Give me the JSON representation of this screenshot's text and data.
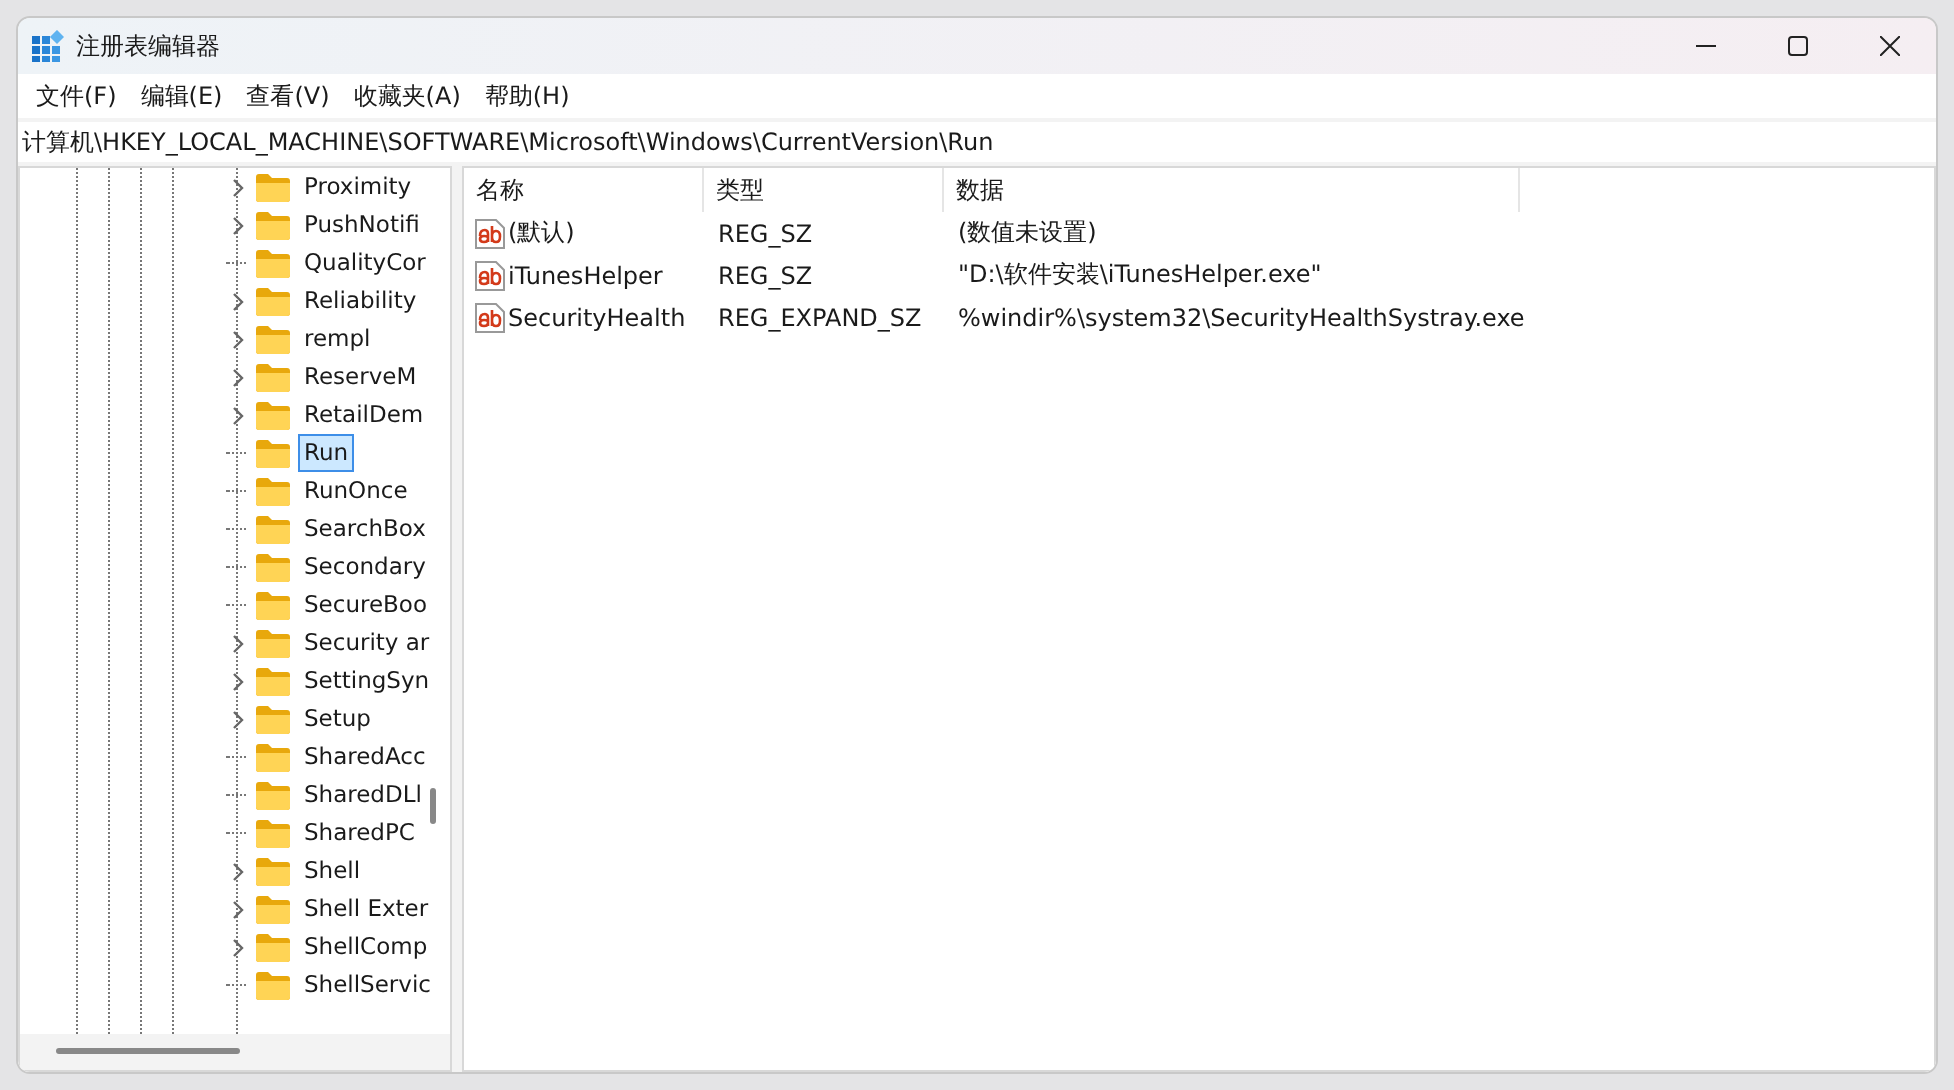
{
  "window": {
    "title": "注册表编辑器"
  },
  "menu": [
    "文件(F)",
    "编辑(E)",
    "查看(V)",
    "收藏夹(A)",
    "帮助(H)"
  ],
  "address": "计算机\\HKEY_LOCAL_MACHINE\\SOFTWARE\\Microsoft\\Windows\\CurrentVersion\\Run",
  "tree": [
    {
      "label": "Proximity",
      "expandable": true,
      "selected": false
    },
    {
      "label": "PushNotifi",
      "expandable": true,
      "selected": false
    },
    {
      "label": "QualityCor",
      "expandable": false,
      "selected": false
    },
    {
      "label": "Reliability",
      "expandable": true,
      "selected": false
    },
    {
      "label": "rempl",
      "expandable": true,
      "selected": false
    },
    {
      "label": "ReserveM",
      "expandable": true,
      "selected": false
    },
    {
      "label": "RetailDem",
      "expandable": true,
      "selected": false
    },
    {
      "label": "Run",
      "expandable": false,
      "selected": true
    },
    {
      "label": "RunOnce",
      "expandable": false,
      "selected": false
    },
    {
      "label": "SearchBox",
      "expandable": false,
      "selected": false
    },
    {
      "label": "Secondary",
      "expandable": false,
      "selected": false
    },
    {
      "label": "SecureBoo",
      "expandable": false,
      "selected": false
    },
    {
      "label": "Security ar",
      "expandable": true,
      "selected": false
    },
    {
      "label": "SettingSyn",
      "expandable": true,
      "selected": false
    },
    {
      "label": "Setup",
      "expandable": true,
      "selected": false
    },
    {
      "label": "SharedAcc",
      "expandable": false,
      "selected": false
    },
    {
      "label": "SharedDLl",
      "expandable": false,
      "selected": false
    },
    {
      "label": "SharedPC",
      "expandable": false,
      "selected": false
    },
    {
      "label": "Shell",
      "expandable": true,
      "selected": false
    },
    {
      "label": "Shell Exter",
      "expandable": true,
      "selected": false
    },
    {
      "label": "ShellComp",
      "expandable": true,
      "selected": false
    },
    {
      "label": "ShellServic",
      "expandable": false,
      "selected": false
    }
  ],
  "table": {
    "columns": [
      "名称",
      "类型",
      "数据"
    ],
    "rows": [
      [
        "(默认)",
        "REG_SZ",
        "(数值未设置)"
      ],
      [
        "iTunesHelper",
        "REG_SZ",
        "\"D:\\软件安装\\iTunesHelper.exe\""
      ],
      [
        "SecurityHealth",
        "REG_EXPAND_SZ",
        "%windir%\\system32\\SecurityHealthSystray.exe"
      ]
    ]
  }
}
